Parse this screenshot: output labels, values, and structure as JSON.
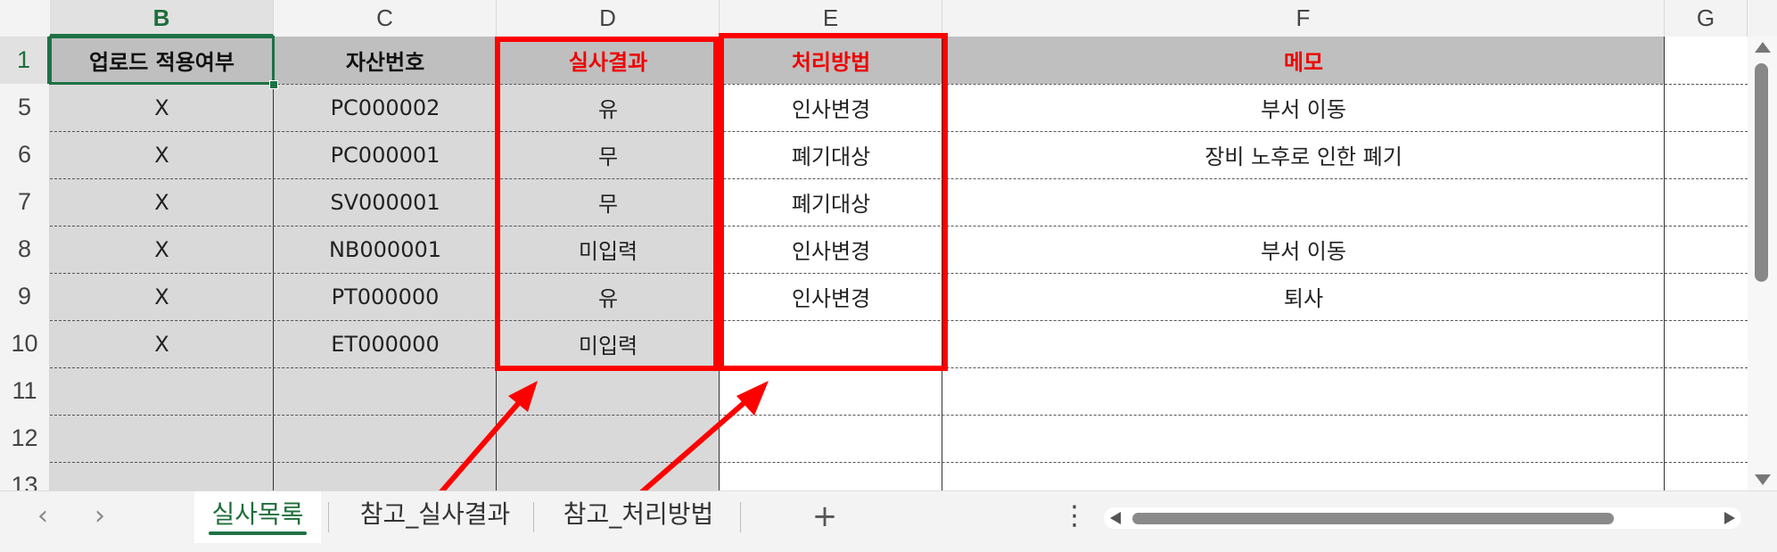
{
  "columns": [
    "B",
    "C",
    "D",
    "E",
    "F",
    "G"
  ],
  "active_column": "B",
  "rows": [
    "1",
    "5",
    "6",
    "7",
    "8",
    "9",
    "10",
    "11",
    "12",
    "13"
  ],
  "active_row": "1",
  "header": {
    "b": "업로드 적용여부",
    "c": "자산번호",
    "d": "실사결과",
    "e": "처리방법",
    "f": "메모"
  },
  "data_rows": [
    {
      "row": "5",
      "b": "X",
      "c": "PC000002",
      "d": "유",
      "e": "인사변경",
      "f": "부서 이동"
    },
    {
      "row": "6",
      "b": "X",
      "c": "PC000001",
      "d": "무",
      "e": "폐기대상",
      "f": "장비 노후로 인한 폐기"
    },
    {
      "row": "7",
      "b": "X",
      "c": "SV000001",
      "d": "무",
      "e": "폐기대상",
      "f": ""
    },
    {
      "row": "8",
      "b": "X",
      "c": "NB000001",
      "d": "미입력",
      "e": "인사변경",
      "f": "부서 이동"
    },
    {
      "row": "9",
      "b": "X",
      "c": "PT000000",
      "d": "유",
      "e": "인사변경",
      "f": "퇴사"
    },
    {
      "row": "10",
      "b": "X",
      "c": "ET000000",
      "d": "미입력",
      "e": "",
      "f": ""
    }
  ],
  "sheet_tabs": [
    {
      "label": "실사목록",
      "active": true
    },
    {
      "label": "참고_실사결과",
      "active": false
    },
    {
      "label": "참고_처리방법",
      "active": false
    }
  ],
  "add_sheet_label": "+",
  "more_menu_label": "⋮",
  "nav_prev": "‹",
  "nav_next": "›",
  "colors": {
    "header_fill": "#bfbfbf",
    "gray_fill": "#d9d9d9",
    "red_text": "#ee0000",
    "annotation_red": "#ff0000",
    "excel_green": "#1e7145"
  },
  "icons": {
    "arrow_annotation": "red-arrow-icon",
    "add": "plus-icon",
    "more": "vertical-ellipsis-icon"
  }
}
